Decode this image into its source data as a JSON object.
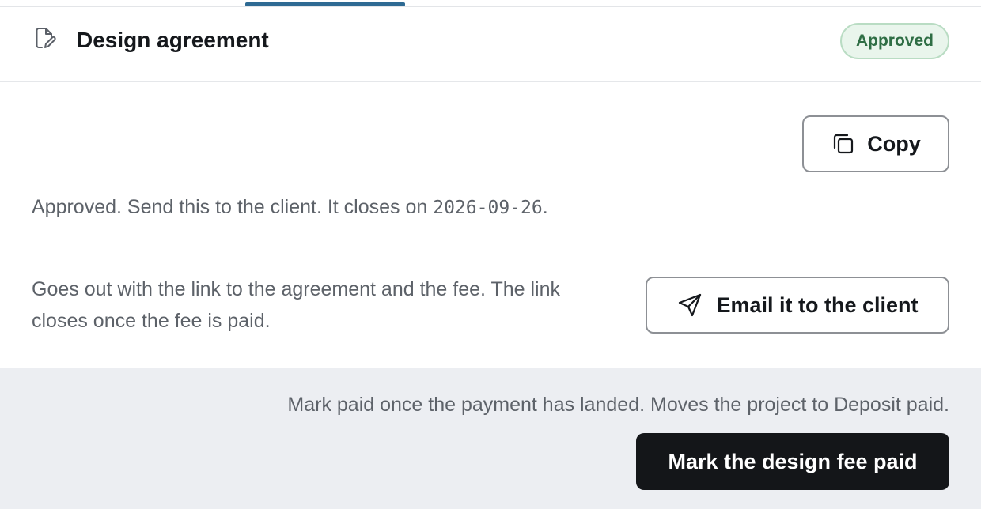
{
  "header": {
    "title": "Design agreement",
    "status_badge": "Approved",
    "icon": "document-edit-icon"
  },
  "copy_button": {
    "label": "Copy",
    "icon": "copy-icon"
  },
  "status_message": {
    "text": "Approved. Send this to the client. It closes on ",
    "close_date": "2026-09-26",
    "suffix": "."
  },
  "email_section": {
    "description": "Goes out with the link to the agreement and the fee. The link closes once the fee is paid.",
    "button_label": "Email it to the client",
    "icon": "send-icon"
  },
  "footer": {
    "note": "Mark paid once the payment has landed. Moves the project to Deposit paid.",
    "button_label": "Mark the design fee paid"
  },
  "colors": {
    "accent": "#2e6a93",
    "badge_text": "#2f6e45",
    "badge_bg": "#e9f5ec",
    "primary_button": "#141619",
    "footer_bg": "#eceef2"
  }
}
